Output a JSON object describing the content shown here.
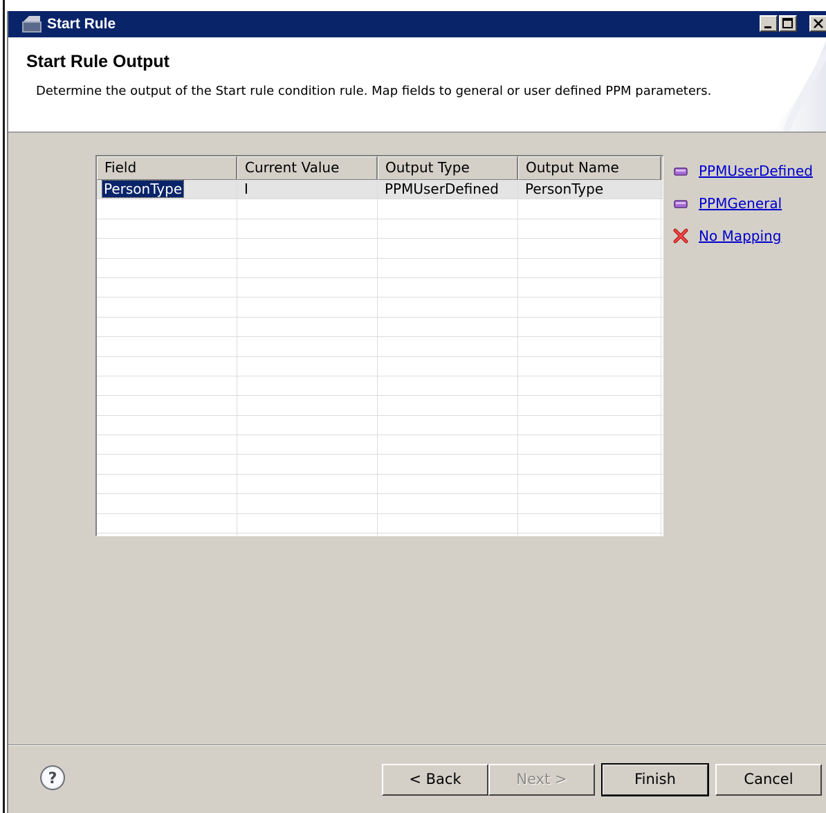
{
  "window": {
    "title": "Start Rule"
  },
  "header": {
    "title": "Start Rule Output",
    "description": "Determine the output of the Start rule condition rule. Map fields to general or user defined PPM parameters."
  },
  "table": {
    "columns": [
      "Field",
      "Current Value",
      "Output Type",
      "Output Name"
    ],
    "rows": [
      {
        "field": "PersonType",
        "current_value": "I",
        "output_type": "PPMUserDefined",
        "output_name": "PersonType"
      }
    ]
  },
  "mapping_links": [
    {
      "label": "PPMUserDefined",
      "icon": "purple-parameter-icon"
    },
    {
      "label": "PPMGeneral",
      "icon": "purple-parameter-icon"
    },
    {
      "label": "No Mapping",
      "icon": "red-x-icon"
    }
  ],
  "buttons": {
    "back": "< Back",
    "next": "Next >",
    "finish": "Finish",
    "cancel": "Cancel"
  },
  "colors": {
    "titlebar": "#0a246a",
    "dialog_face": "#d4d0c8",
    "link": "#0000cc",
    "selection": "#0a246a"
  }
}
